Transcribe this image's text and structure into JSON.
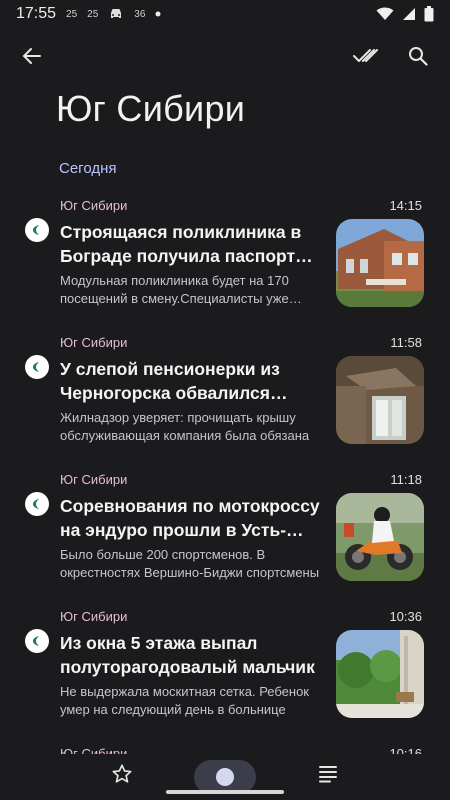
{
  "status_bar": {
    "time": "17:55",
    "indicators": [
      "25",
      "25",
      "36"
    ],
    "icons": [
      "car-icon",
      "dot-icon",
      "wifi-icon",
      "signal-icon",
      "battery-icon"
    ]
  },
  "toolbar": {
    "icons": [
      "back-arrow-icon",
      "double-check-icon",
      "search-icon"
    ]
  },
  "page": {
    "title": "Юг Сибири",
    "section": "Сегодня"
  },
  "news": [
    {
      "source": "Юг Сибири",
      "time": "14:15",
      "title": "Строящаяся поликлиника в Бограде получила паспорт объекта",
      "desc": "Модульная поликлиника будет на 170 посещений в смену.Специалисты уже завершают",
      "thumb": "building"
    },
    {
      "source": "Юг Сибири",
      "time": "11:58",
      "title": "У слепой пенсионерки из Черногорска обвалился потолок",
      "desc": "Жилнадзор уверяет: прочищать крышу обслуживающая компания была обязана",
      "thumb": "ceiling"
    },
    {
      "source": "Юг Сибири",
      "time": "11:18",
      "title": "Соревнования по мотокроссу на эндуро прошли в Усть-Абакане",
      "desc": "Было больше 200 спортсменов. В окрестностях Вершино-Биджи спортсмены",
      "thumb": "motocross"
    },
    {
      "source": "Юг Сибири",
      "time": "10:36",
      "title": "Из окна 5 этажа выпал полуторагодовалый мальчик",
      "desc": "Не выдержала москитная сетка. Ребенок умер на следующий день в больнице",
      "thumb": "window"
    }
  ],
  "partial_item": {
    "source": "Юг Сибири",
    "time": "10:16"
  },
  "bottom_nav": {
    "icons": [
      "star-icon",
      "home-icon",
      "list-icon"
    ]
  },
  "colors": {
    "background": "#1b1b1e",
    "accent_section": "#b9c3ff",
    "source_label": "#e6bdd6",
    "nav_active": "#3b3e4a"
  }
}
